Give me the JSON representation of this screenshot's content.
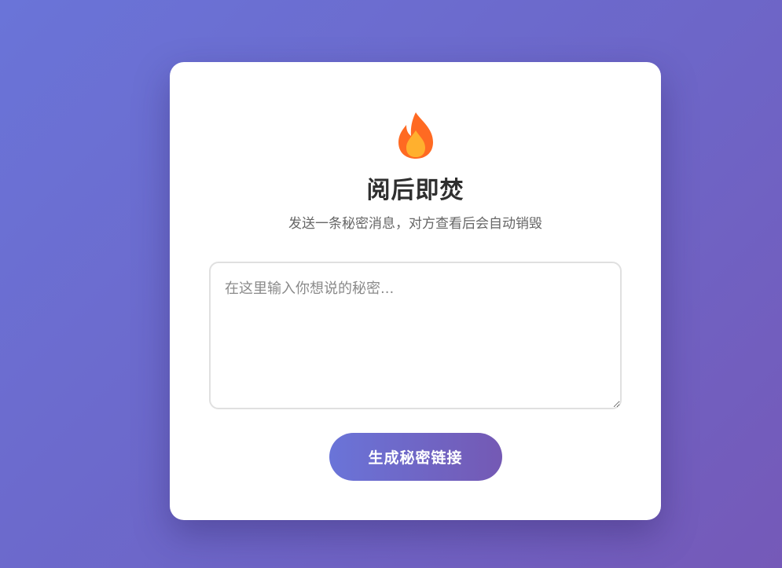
{
  "header": {
    "icon": "fire-icon",
    "title": "阅后即焚",
    "subtitle": "发送一条秘密消息，对方查看后会自动销毁"
  },
  "form": {
    "message_placeholder": "在这里输入你想说的秘密...",
    "message_value": "",
    "submit_label": "生成秘密链接"
  },
  "colors": {
    "background_start": "#6a74d8",
    "background_end": "#7559b8",
    "flame_outer": "#ff6a22",
    "flame_inner": "#ffb02e",
    "button_start": "#6a74d8",
    "button_end": "#7459b4"
  }
}
